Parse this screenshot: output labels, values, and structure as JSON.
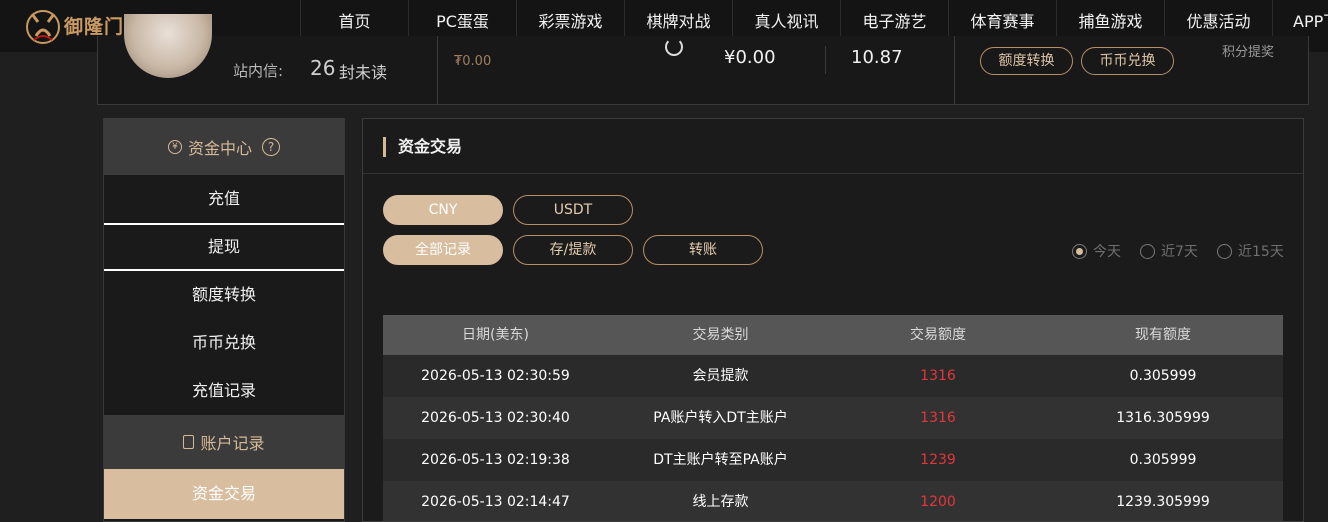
{
  "brand": {
    "logo_text": "御隆门"
  },
  "nav": {
    "items": [
      {
        "label": "首页"
      },
      {
        "label": "PC蛋蛋"
      },
      {
        "label": "彩票游戏"
      },
      {
        "label": "棋牌对战"
      },
      {
        "label": "真人视讯"
      },
      {
        "label": "电子游艺"
      },
      {
        "label": "体育赛事"
      },
      {
        "label": "捕鱼游戏"
      },
      {
        "label": "优惠活动"
      },
      {
        "label": "APP下载"
      }
    ]
  },
  "account": {
    "message_label": "站内信:",
    "message_count": "26",
    "message_unit": "封未读",
    "small_amount": "₮0.00",
    "balance": "¥0.00",
    "points": "10.87",
    "quota_transfer_button": "额度转换",
    "coin_exchange_button": "币币兑换",
    "points_link": "积分提奖"
  },
  "sidebar": {
    "fund_center": "资金中心",
    "help_icon_glyph": "?",
    "coin_icon_glyph": "¥",
    "items": [
      {
        "label": "充值"
      },
      {
        "label": "提现"
      },
      {
        "label": "额度转换"
      },
      {
        "label": "币币兑换"
      },
      {
        "label": "充值记录"
      }
    ],
    "account_records": "账户记录",
    "active_item": "资金交易"
  },
  "main": {
    "title": "资金交易",
    "currency_tabs": [
      {
        "label": "CNY",
        "selected": true
      },
      {
        "label": "USDT",
        "selected": false
      }
    ],
    "record_tabs": [
      {
        "label": "全部记录",
        "selected": true
      },
      {
        "label": "存/提款",
        "selected": false
      },
      {
        "label": "转账",
        "selected": false
      }
    ],
    "date_filters": [
      {
        "label": "今天",
        "selected": true
      },
      {
        "label": "近7天",
        "selected": false
      },
      {
        "label": "近15天",
        "selected": false
      }
    ],
    "table": {
      "headers": [
        "日期(美东)",
        "交易类别",
        "交易额度",
        "现有额度"
      ],
      "rows": [
        [
          "2026-05-13 02:30:59",
          "会员提款",
          "1316",
          "0.305999"
        ],
        [
          "2026-05-13 02:30:40",
          "PA账户转入DT主账户",
          "1316",
          "1316.305999"
        ],
        [
          "2026-05-13 02:19:38",
          "DT主账户转至PA账户",
          "1239",
          "0.305999"
        ],
        [
          "2026-05-13 02:14:47",
          "线上存款",
          "1200",
          "1239.305999"
        ]
      ]
    }
  },
  "colors": {
    "accent": "#d8bd9e",
    "negative": "#e2373a",
    "background": "#1f1f1f"
  }
}
